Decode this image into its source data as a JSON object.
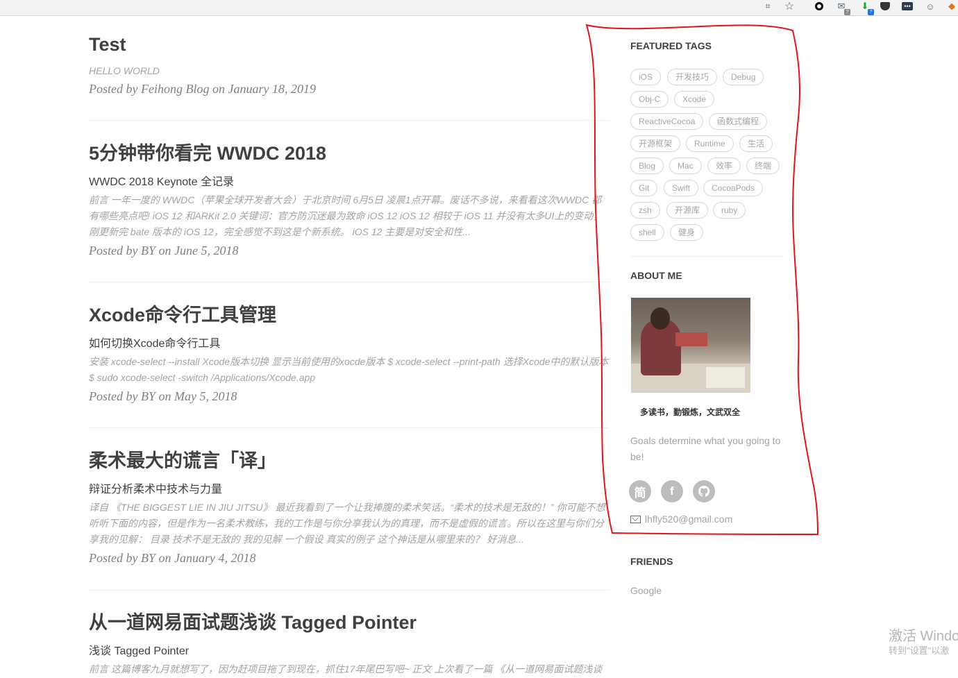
{
  "browser": {
    "icons": [
      "translate-icon",
      "bookmark-star-icon",
      "circle-extension-icon",
      "gmail-icon",
      "download-extension-icon",
      "pocket-icon",
      "more-extension-icon",
      "avatar-extension-icon",
      "metamask-fox-icon"
    ],
    "badges": {
      "gmail": "?",
      "green": "?"
    }
  },
  "posts": [
    {
      "title": "Test",
      "subtitle": "HELLO WORLD",
      "excerpt": "",
      "meta": "Posted by Feihong Blog on January 18, 2019"
    },
    {
      "title": "5分钟带你看完 WWDC 2018",
      "subtitle": "WWDC 2018 Keynote 全记录",
      "excerpt": "前言 一年一度的 WWDC（苹果全球开发者大会）于北京时间 6月5日 凌晨1点开幕。废话不多说，来看看这次WWDC 都有哪些亮点吧! iOS 12 和ARKit 2.0 关键词：官方防沉迷最为致命 iOS 12 iOS 12 相较于 iOS 11 并没有太多UI上的变动，刚更新完 bate 版本的 iOS 12，完全感觉不到这是个新系统。 iOS 12 主要是对安全和性...",
      "meta": "Posted by BY on June 5, 2018"
    },
    {
      "title": "Xcode命令行工具管理",
      "subtitle": "如何切换Xcode命令行工具",
      "excerpt": "安装 xcode-select --install Xcode版本切换 显示当前使用的xocde版本 $ xcode-select --print-path 选择Xcode中的默认版本 $ sudo xcode-select -switch /Applications/Xcode.app",
      "meta": "Posted by BY on May 5, 2018"
    },
    {
      "title": "柔术最大的谎言「译」",
      "subtitle": "辩证分析柔术中技术与力量",
      "excerpt": "译自 《THE BIGGEST LIE IN JIU JITSU》 最近我看到了一个让我捧腹的柔术笑话。“柔术的技术是无敌的！” 你可能不想听听下面的内容，但是作为一名柔术教练，我的工作是与你分享我认为的真理，而不是虚假的谎言。所以在这里与你们分享我的见解： 目录 技术不是无敌的 我的见解 一个假设 真实的例子 这个神话是从哪里来的？ 好消息...",
      "meta": "Posted by BY on January 4, 2018"
    },
    {
      "title": "从一道网易面试题浅谈 Tagged Pointer",
      "subtitle": "浅谈 Tagged Pointer",
      "excerpt": "前言 这篇博客九月就想写了，因为赶项目拖了到现在，抓住17年尾巴写吧~ 正文 上次看了一篇 《从一道网易面试题浅谈",
      "meta": ""
    }
  ],
  "sidebar": {
    "featured_tags_title": "FEATURED TAGS",
    "tags": [
      "iOS",
      "开发技巧",
      "Debug",
      "Obj-C",
      "Xcode",
      "ReactiveCocoa",
      "函数式编程",
      "开源框架",
      "Runtime",
      "生活",
      "Blog",
      "Mac",
      "效率",
      "终端",
      "Git",
      "Swift",
      "CocoaPods",
      "zsh",
      "开源库",
      "ruby",
      "shell",
      "健身"
    ],
    "about_title": "ABOUT ME",
    "motto": "多读书，勤锻炼，文武双全",
    "about_text": "Goals determine what you going to be!",
    "social": [
      {
        "name": "jianshu",
        "glyph": "简"
      },
      {
        "name": "facebook",
        "glyph": "f"
      },
      {
        "name": "github",
        "glyph": "●"
      }
    ],
    "email": "lhfly520@gmail.com",
    "friends_title": "FRIENDS",
    "friends": [
      "Google"
    ]
  },
  "watermark": {
    "line1": "激活 Windo",
    "line2": "转到\"设置\"以激"
  },
  "colors": {
    "annotation": "#e0141e",
    "tag_border": "#d9d9d9",
    "muted_text": "#a3a3a3"
  }
}
